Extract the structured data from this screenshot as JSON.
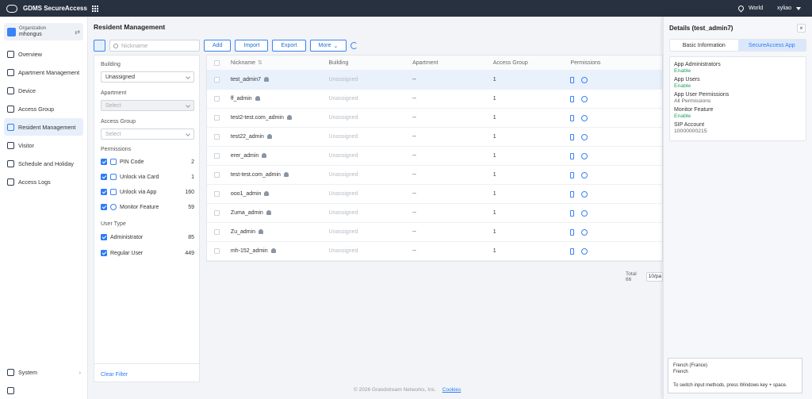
{
  "topbar": {
    "app_title": "GDMS SecureAccess",
    "region": "World",
    "user": "xyliao"
  },
  "sidebar": {
    "org_label": "Organization",
    "org_name": "mhongus",
    "items": [
      {
        "label": "Overview",
        "icon": "overview-icon"
      },
      {
        "label": "Apartment Management",
        "icon": "apartment-icon"
      },
      {
        "label": "Device",
        "icon": "device-icon"
      },
      {
        "label": "Access Group",
        "icon": "access-group-icon"
      },
      {
        "label": "Resident Management",
        "icon": "resident-icon",
        "active": true
      },
      {
        "label": "Visitor",
        "icon": "visitor-icon"
      },
      {
        "label": "Schedule and Holiday",
        "icon": "calendar-icon"
      },
      {
        "label": "Access Logs",
        "icon": "logs-icon"
      }
    ],
    "system_label": "System"
  },
  "main": {
    "title": "Resident Management",
    "search_placeholder": "Nickname",
    "buttons": {
      "add": "Add",
      "import": "Import",
      "export": "Export",
      "more": "More"
    }
  },
  "filter": {
    "building_label": "Building",
    "building_value": "Unassigned",
    "apartment_label": "Apartment",
    "apartment_placeholder": "Select",
    "access_group_label": "Access Group",
    "access_group_placeholder": "Select",
    "permissions_label": "Permissions",
    "permissions": [
      {
        "label": "PIN Code",
        "count": "2"
      },
      {
        "label": "Unlock via Card",
        "count": "1"
      },
      {
        "label": "Unlock via App",
        "count": "160"
      },
      {
        "label": "Monitor Feature",
        "count": "59"
      }
    ],
    "user_type_label": "User Type",
    "user_types": [
      {
        "label": "Administrator",
        "count": "85"
      },
      {
        "label": "Regular User",
        "count": "449"
      }
    ],
    "clear_label": "Clear Filter"
  },
  "table": {
    "columns": [
      "Nickname",
      "Building",
      "Apartment",
      "Access Group",
      "Permissions"
    ],
    "rows": [
      {
        "nickname": "test_admin7",
        "building": "Unassigned",
        "apartment": "--",
        "access_group": "1",
        "selected": true
      },
      {
        "nickname": "ff_admin",
        "building": "Unassigned",
        "apartment": "--",
        "access_group": "1"
      },
      {
        "nickname": "test2-test.com_admin",
        "building": "Unassigned",
        "apartment": "--",
        "access_group": "1"
      },
      {
        "nickname": "test22_admin",
        "building": "Unassigned",
        "apartment": "--",
        "access_group": "1"
      },
      {
        "nickname": "erer_admin",
        "building": "Unassigned",
        "apartment": "--",
        "access_group": "1"
      },
      {
        "nickname": "test-test.com_admin",
        "building": "Unassigned",
        "apartment": "--",
        "access_group": "1"
      },
      {
        "nickname": "ooo1_admin",
        "building": "Unassigned",
        "apartment": "--",
        "access_group": "1"
      },
      {
        "nickname": "Zuma_admin",
        "building": "Unassigned",
        "apartment": "--",
        "access_group": "1"
      },
      {
        "nickname": "Zu_admin",
        "building": "Unassigned",
        "apartment": "--",
        "access_group": "1"
      },
      {
        "nickname": "mh-152_admin",
        "building": "Unassigned",
        "apartment": "--",
        "access_group": "1"
      }
    ],
    "total": "Total 66",
    "page_size": "10/pa"
  },
  "footer": {
    "copyright": "© 2026 Grandstream Networks, Inc.",
    "cookies": "Cookies"
  },
  "details": {
    "title": "Details (test_admin7)",
    "tabs": [
      "Basic Information",
      "SecureAccess App"
    ],
    "fields": [
      {
        "label": "App Administrators",
        "value": "Enable",
        "ok": true
      },
      {
        "label": "App Users",
        "value": "Enable",
        "ok": true
      },
      {
        "label": "App User Permissions",
        "value": "All Permissions",
        "ok": false
      },
      {
        "label": "Monitor Feature",
        "value": "Enable",
        "ok": true
      },
      {
        "label": "SIP Account",
        "value": "10000000215",
        "ok": false
      }
    ]
  },
  "ime": {
    "line1": "French (France)",
    "line2": "French",
    "line3": "To switch input methods, press Windows key + space."
  },
  "colors": {
    "topbar": "#283140",
    "accent": "#2e7cf6",
    "enable": "#22a05a"
  }
}
